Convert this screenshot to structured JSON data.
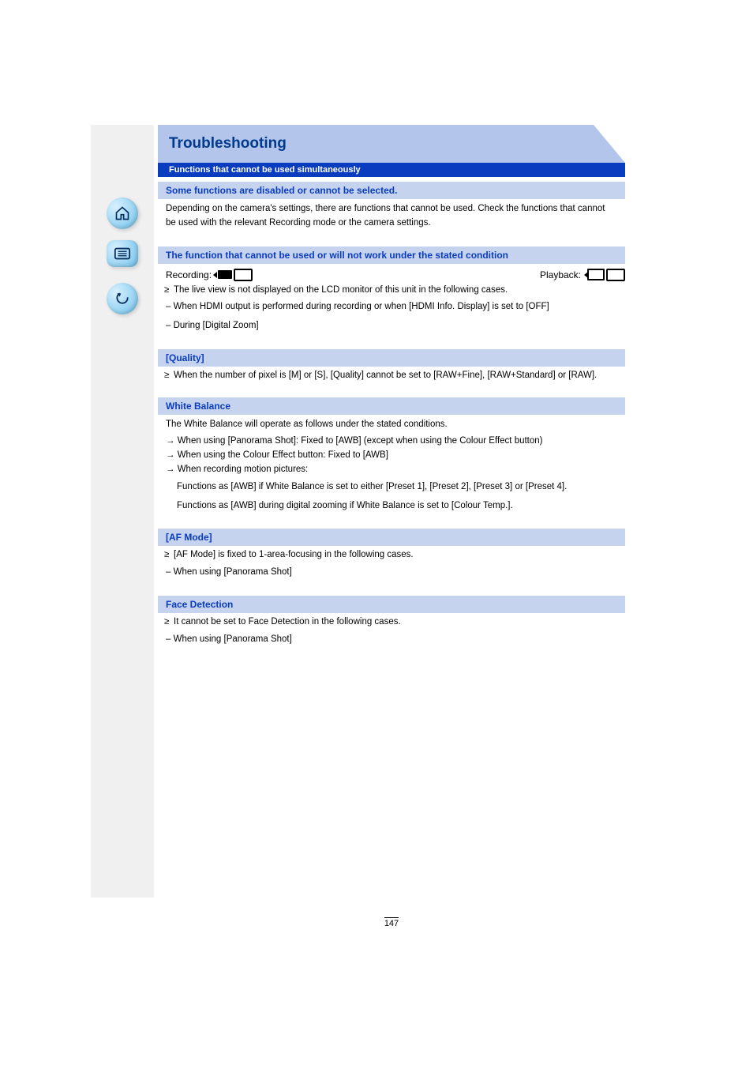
{
  "banner": "Troubleshooting",
  "strip": "Functions that cannot be used simultaneously",
  "sections": [
    {
      "title": "Some functions are disabled or cannot be selected.",
      "items": [
        {
          "type": "desc",
          "text": "Depending on the camera's settings, there are functions that cannot be used. Check the functions that cannot be used with the relevant Recording mode or the camera settings."
        }
      ]
    },
    {
      "title": "The function that cannot be used or will not work under the stated condition",
      "items": [
        {
          "type": "rec_icons"
        },
        {
          "type": "bullet",
          "text": "The live view is not displayed on the LCD monitor of this unit in the following cases."
        },
        {
          "type": "desc",
          "text": "– When HDMI output is performed during recording or when [HDMI Info. Display] is set to [OFF]"
        },
        {
          "type": "desc",
          "text": "– During [Digital Zoom]"
        }
      ]
    },
    {
      "title": "[Quality]",
      "items": [
        {
          "type": "bullet",
          "text": "When the number of pixel is [M] or [S], [Quality] cannot be set to [RAW+Fine], [RAW+Standard] or [RAW]."
        }
      ]
    },
    {
      "title": "White Balance",
      "items": [
        {
          "type": "desc",
          "text": "The White Balance will operate as follows under the stated conditions."
        },
        {
          "type": "arrow",
          "text": "→ When using [Panorama Shot]: Fixed to [AWB] (except when using the Colour Effect button)"
        },
        {
          "type": "arrow",
          "text": "→ When using the Colour Effect button: Fixed to [AWB]"
        },
        {
          "type": "arrow",
          "text": "→ When recording motion pictures:"
        },
        {
          "type": "desc",
          "text": "Functions as [AWB] if White Balance is set to either [Preset 1], [Preset 2], [Preset 3] or [Preset 4]."
        },
        {
          "type": "desc",
          "text": "Functions as [AWB] during digital zooming if White Balance is set to [Colour Temp.]."
        }
      ]
    },
    {
      "title": "[AF Mode]",
      "items": [
        {
          "type": "bullet",
          "text": "[AF Mode] is fixed to 1-area-focusing in the following cases."
        },
        {
          "type": "desc",
          "text": "– When using [Panorama Shot]"
        }
      ]
    },
    {
      "title": "Face Detection",
      "items": [
        {
          "type": "bullet",
          "text": "It cannot be set to Face Detection in the following cases."
        },
        {
          "type": "desc",
          "text": "– When using [Panorama Shot]"
        }
      ]
    }
  ],
  "page_number": "147"
}
